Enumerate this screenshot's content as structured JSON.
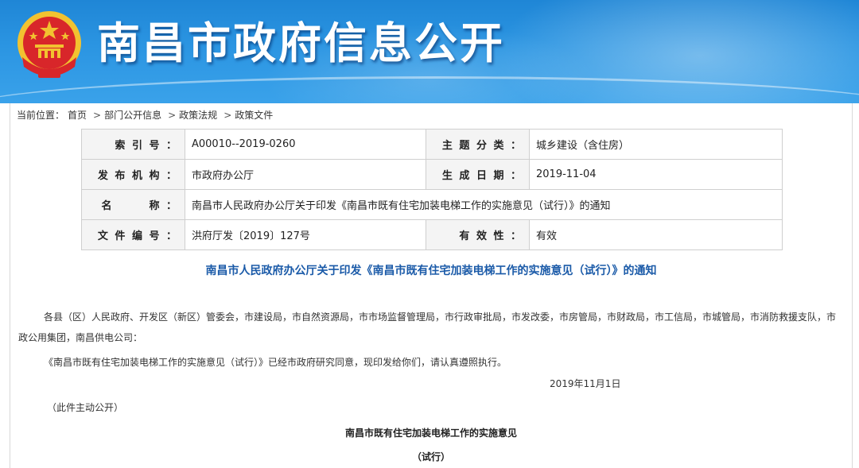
{
  "header": {
    "site_title": "南昌市政府信息公开",
    "emblem_icon": "national-emblem-icon"
  },
  "breadcrumb": {
    "label": "当前位置：",
    "items": [
      "首页",
      "部门公开信息",
      "政策法规",
      "政策文件"
    ],
    "separator": ">"
  },
  "meta": {
    "index_label": "索 引 号 ：",
    "index_value": "A00010--2019-0260",
    "category_label": "主 题 分 类 ：",
    "category_value": "城乡建设（含住房）",
    "publisher_label": "发 布 机 构 ：",
    "publisher_value": "市政府办公厅",
    "date_label": "生 成 日 期 ：",
    "date_value": "2019-11-04",
    "name_label": "名　　　称 ：",
    "name_value": "南昌市人民政府办公厅关于印发《南昌市既有住宅加装电梯工作的实施意见（试行）》的通知",
    "docno_label": "文 件 编 号 ：",
    "docno_value": "洪府厅发〔2019〕127号",
    "validity_label": "有 效 性 ：",
    "validity_value": "有效"
  },
  "document": {
    "title": "南昌市人民政府办公厅关于印发《南昌市既有住宅加装电梯工作的实施意见（试行）》的通知",
    "addressees": "各县（区）人民政府、开发区（新区）管委会，市建设局，市自然资源局，市市场监督管理局，市行政审批局，市发改委，市房管局，市财政局，市工信局，市城管局，市消防救援支队，市政公用集团，南昌供电公司：",
    "body": "《南昌市既有住宅加装电梯工作的实施意见（试行）》已经市政府研究同意，现印发给你们，请认真遵照执行。",
    "date": "2019年11月1日",
    "notice": "（此件主动公开）",
    "subtitle": "南昌市既有住宅加装电梯工作的实施意见",
    "subtitle2": "（试行）"
  },
  "colors": {
    "header_blue": "#2b95e2",
    "title_blue": "#1a5aa8",
    "emblem_red": "#d8262a",
    "emblem_gold": "#f2c230"
  }
}
